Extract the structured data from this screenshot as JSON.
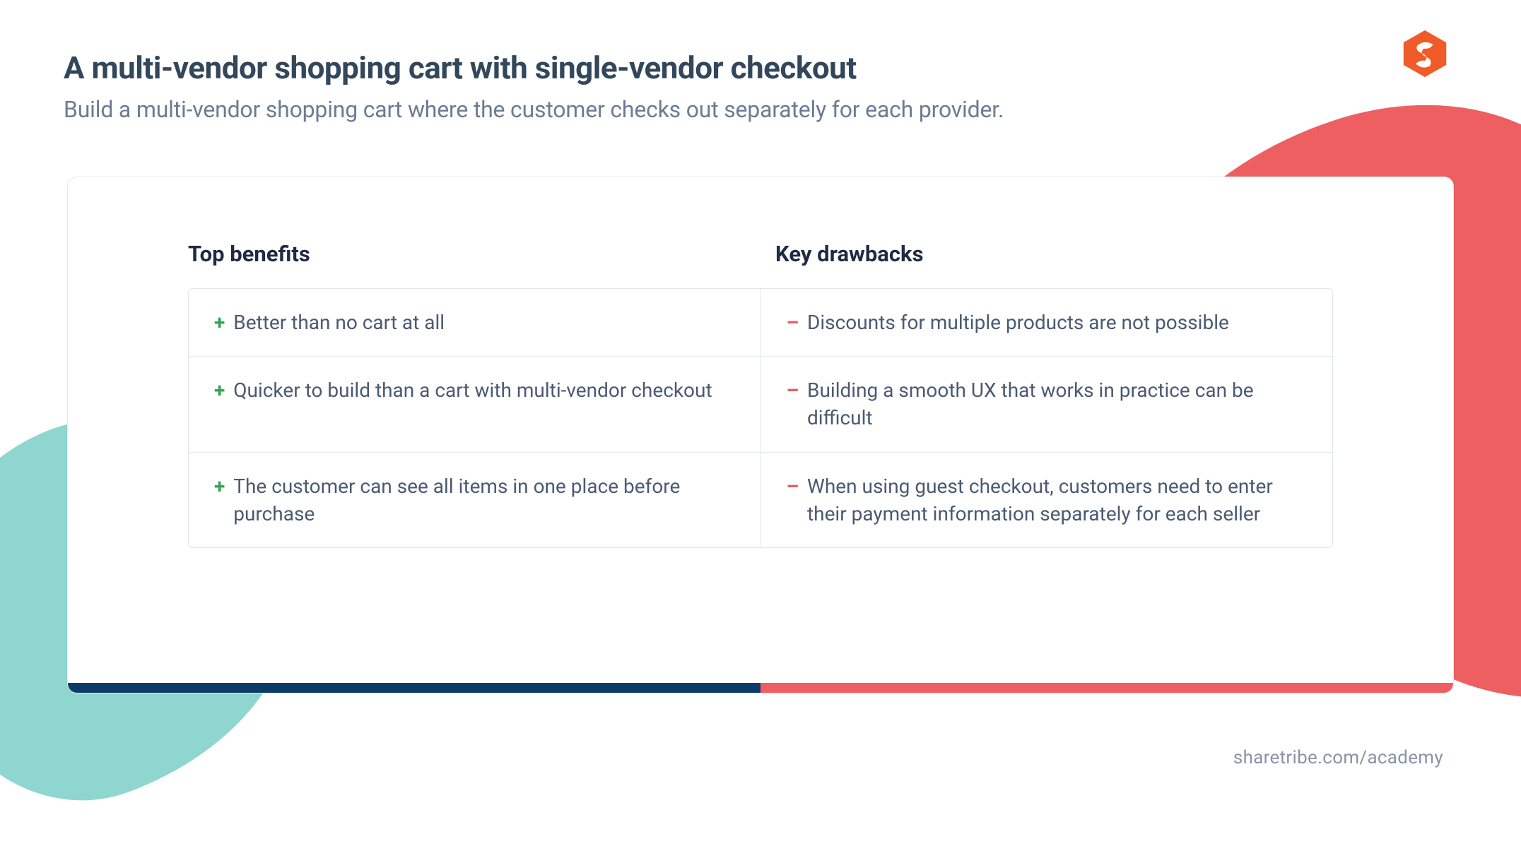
{
  "header": {
    "title": "A multi-vendor shopping cart with single-vendor checkout",
    "subtitle": "Build a multi-vendor shopping cart where the customer checks out separately for each provider."
  },
  "logo": {
    "name": "sharetribe-logo"
  },
  "columns": {
    "benefits_header": "Top benefits",
    "drawbacks_header": "Key drawbacks"
  },
  "rows": [
    {
      "benefit": "Better than no cart at all",
      "drawback": "Discounts for multiple products are not possible"
    },
    {
      "benefit": "Quicker to build than a cart with multi-vendor checkout",
      "drawback": "Building a smooth UX that works in practice can be difficult"
    },
    {
      "benefit": "The customer can see all items in one place before purchase",
      "drawback": "When using guest checkout, customers need to enter their payment information separately for each seller"
    }
  ],
  "footer": {
    "link_text": "sharetribe.com/academy"
  },
  "colors": {
    "accent_red": "#ed5f61",
    "accent_teal": "#8fd6d0",
    "navy": "#0b3b66",
    "heading": "#33475b",
    "body": "#4a5a72",
    "subtle": "#6b7c93",
    "plus": "#2fa84f"
  }
}
